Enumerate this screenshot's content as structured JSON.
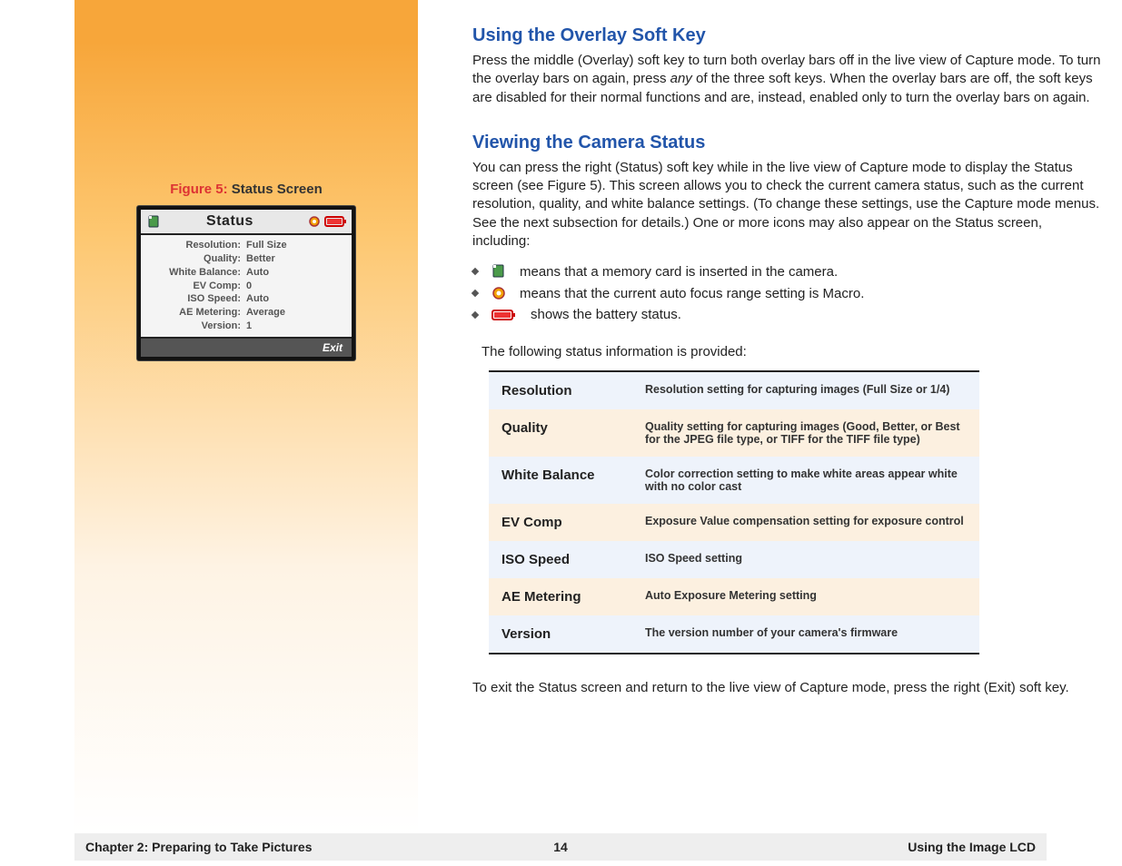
{
  "figure": {
    "label_prefix": "Figure 5:",
    "label_title": " Status Screen",
    "lcd_title": "Status",
    "exit": "Exit",
    "rows": [
      {
        "label": "Resolution:",
        "value": "Full Size"
      },
      {
        "label": "Quality:",
        "value": "Better"
      },
      {
        "label": "White Balance:",
        "value": "Auto"
      },
      {
        "label": "EV Comp:",
        "value": "0"
      },
      {
        "label": "ISO Speed:",
        "value": "Auto"
      },
      {
        "label": "AE Metering:",
        "value": "Average"
      },
      {
        "label": "Version:",
        "value": "1"
      }
    ]
  },
  "section1": {
    "heading": "Using the Overlay Soft Key",
    "body_pre": "Press the middle (Overlay) soft key to turn both overlay bars off in the live view of Capture mode. To turn the overlay bars on again, press ",
    "body_em": "any",
    "body_post": "  of the three soft keys. When the overlay bars are off, the soft keys are disabled for their normal functions and are, instead, enabled only to turn the overlay bars on again."
  },
  "section2": {
    "heading": "Viewing the Camera Status",
    "body": "You can press the right (Status) soft key while in the live view of Capture mode to display the Status screen (see Figure 5). This screen allows you to check the current camera status, such as the current resolution, quality, and white balance settings. (To change these settings, use the Capture mode menus. See the next subsection for details.) One or more icons may also appear on the Status screen, including:",
    "bullets": [
      "means that a memory card is inserted in the camera.",
      "means that the current auto focus range setting is Macro.",
      "shows the battery status."
    ],
    "table_intro": "The following status information is provided:",
    "table": [
      {
        "name": "Resolution",
        "desc": "Resolution setting for capturing images (Full Size or 1/4)"
      },
      {
        "name": "Quality",
        "desc": "Quality setting for capturing images (Good, Better, or Best for the JPEG file type, or TIFF for the TIFF file type)"
      },
      {
        "name": "White Balance",
        "desc": "Color correction setting to make white areas appear white with no color cast"
      },
      {
        "name": "EV Comp",
        "desc": "Exposure Value compensation setting for exposure control"
      },
      {
        "name": "ISO Speed",
        "desc": "ISO Speed setting"
      },
      {
        "name": "AE Metering",
        "desc": "Auto Exposure Metering setting"
      },
      {
        "name": "Version",
        "desc": "The version number of your camera's firmware"
      }
    ],
    "closing": "To exit the Status screen and return to the live view of Capture mode, press the right (Exit) soft key."
  },
  "footer": {
    "left": "Chapter 2: Preparing to Take Pictures",
    "center": "14",
    "right": "Using the Image LCD"
  }
}
